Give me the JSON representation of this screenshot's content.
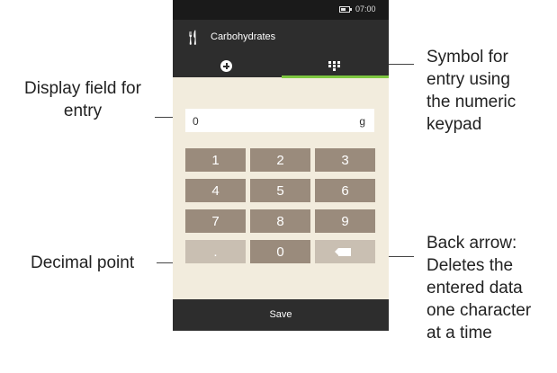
{
  "phone": {
    "status": {
      "time": "07:00"
    },
    "title": "Carbohydrates",
    "entry": {
      "value": "0",
      "unit": "g"
    },
    "keys": [
      "1",
      "2",
      "3",
      "4",
      "5",
      "6",
      "7",
      "8",
      "9",
      ".",
      "0"
    ],
    "save_label": "Save"
  },
  "annotations": {
    "display_field": [
      "Display field for",
      "entry"
    ],
    "keypad_symbol": [
      "Symbol for",
      "entry using",
      "the numeric",
      "keypad"
    ],
    "decimal_point": [
      "Decimal point"
    ],
    "back_arrow": [
      "Back arrow:",
      "Deletes the",
      "entered data",
      "one character",
      "at a time"
    ]
  },
  "colors": {
    "phone_background": "#f2ecdd",
    "bar_dark": "#2d2d2d",
    "key": "#9a8b7c",
    "key_light": "#c9bfb2",
    "active_tab": "#7dc740"
  }
}
